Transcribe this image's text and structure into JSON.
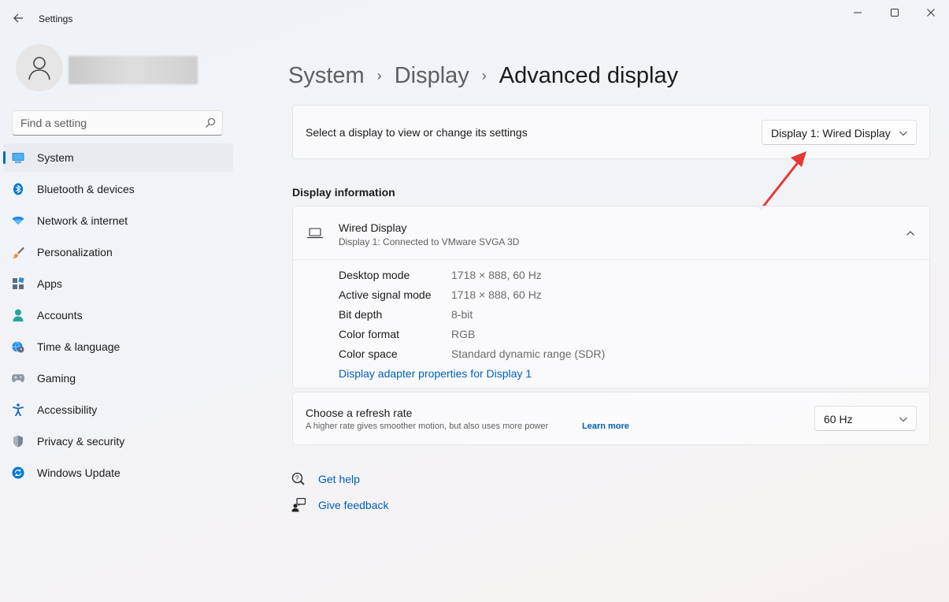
{
  "window": {
    "title": "Settings",
    "back_icon": "arrow-left-icon",
    "controls": [
      "minimize-icon",
      "maximize-icon",
      "close-icon"
    ]
  },
  "search": {
    "placeholder": "Find a setting",
    "value": ""
  },
  "sidebar": {
    "items": [
      {
        "label": "System",
        "icon": "monitor-icon",
        "active": true
      },
      {
        "label": "Bluetooth & devices",
        "icon": "bluetooth-icon"
      },
      {
        "label": "Network & internet",
        "icon": "wifi-icon"
      },
      {
        "label": "Personalization",
        "icon": "brush-icon"
      },
      {
        "label": "Apps",
        "icon": "apps-icon"
      },
      {
        "label": "Accounts",
        "icon": "person-icon"
      },
      {
        "label": "Time & language",
        "icon": "globe-clock-icon"
      },
      {
        "label": "Gaming",
        "icon": "gamepad-icon"
      },
      {
        "label": "Accessibility",
        "icon": "accessibility-icon"
      },
      {
        "label": "Privacy & security",
        "icon": "shield-icon"
      },
      {
        "label": "Windows Update",
        "icon": "sync-icon"
      }
    ]
  },
  "breadcrumb": {
    "items": [
      "System",
      "Display"
    ],
    "current": "Advanced display",
    "separator": "›"
  },
  "display_select": {
    "label": "Select a display to view or change its settings",
    "selected": "Display 1: Wired Display"
  },
  "display_info": {
    "section_title": "Display information",
    "name": "Wired Display",
    "subtitle": "Display 1: Connected to VMware SVGA 3D",
    "rows": [
      {
        "label": "Desktop mode",
        "value": "1718 × 888, 60 Hz"
      },
      {
        "label": "Active signal mode",
        "value": "1718 × 888, 60 Hz"
      },
      {
        "label": "Bit depth",
        "value": "8-bit"
      },
      {
        "label": "Color format",
        "value": "RGB"
      },
      {
        "label": "Color space",
        "value": "Standard dynamic range (SDR)"
      }
    ],
    "adapter_link": "Display adapter properties for Display 1"
  },
  "refresh_rate": {
    "title": "Choose a refresh rate",
    "description": "A higher rate gives smoother motion, but also uses more power",
    "learn_more": "Learn more",
    "selected": "60 Hz"
  },
  "help": {
    "get_help": "Get help",
    "give_feedback": "Give feedback"
  },
  "colors": {
    "accent": "#0067c0",
    "link": "#005fb8",
    "annotation_arrow": "#e53935"
  }
}
